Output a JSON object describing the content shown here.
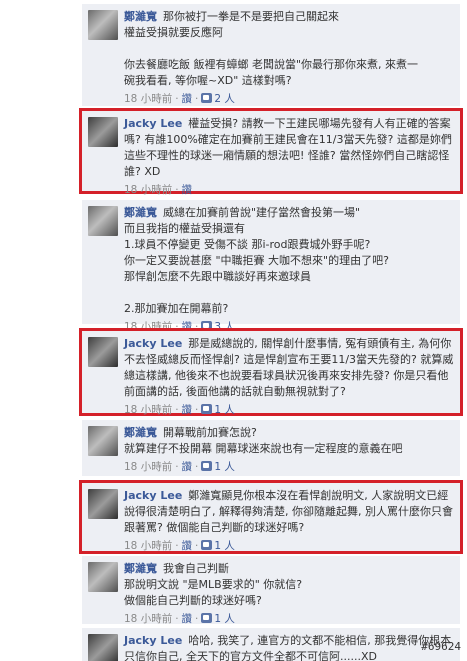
{
  "comments": [
    {
      "author": "鄭濰寬",
      "lines": [
        "那你被打一拳是不是要把自己關起來",
        "權益受損就要反應阿",
        "",
        "你去餐廳吃飯 飯裡有蟑螂 老闆說當\"你最行那你來煮, 來煮一",
        "碗我看看, 等你喔~XD\" 這樣對嗎?"
      ],
      "time": "18 小時前",
      "action": "讚",
      "likes": "2 人"
    },
    {
      "author": "Jacky Lee",
      "lines": [
        "權益受損? 請教一下王建民哪場先發有人有正確的答案嗎? 有誰100%確定在加賽前王建民會在11/3當天先發? 這都是妳們這些不理性的球迷一廂情願的想法吧! 怪誰? 當然怪妳們自己瞎認怪誰? XD"
      ],
      "time": "18 小時前",
      "action": "讚",
      "likes": ""
    },
    {
      "author": "鄭濰寬",
      "lines": [
        "威總在加賽前曾說\"建仔當然會投第一場\"",
        "而且我指的權益受損還有",
        "1.球員不停變更 受傷不談 那i-rod跟費城外野手呢?",
        "你一定又要說甚麼 \"中職拒賽 大咖不想來\"的理由了吧?",
        "那悍創怎麼不先跟中職談好再來邀球員",
        "",
        "2.那加賽加在開幕前?"
      ],
      "time": "18 小時前",
      "action": "讚",
      "likes": "3 人"
    },
    {
      "author": "Jacky Lee",
      "lines": [
        "那是威總說的, 關悍創什麼事情, 冤有頭債有主, 為何你不去怪威總反而怪悍創? 這是悍創宣布王要11/3當天先發的? 就算威總這樣講, 他後來不也說要看球員狀況後再來安排先發? 你是只看他前面講的話, 後面他講的話就自動無視就對了?"
      ],
      "time": "18 小時前",
      "action": "讚",
      "likes": "1 人"
    },
    {
      "author": "鄭濰寬",
      "lines": [
        "開幕戰前加賽怎說?",
        "就算建仔不投開幕 開幕球迷來說也有一定程度的意義在吧"
      ],
      "time": "18 小時前",
      "action": "讚",
      "likes": "1 人"
    },
    {
      "author": "Jacky Lee",
      "lines": [
        "鄭濰寬顯見你根本沒在看悍創說明文, 人家說明文已經說得很清楚明白了, 解釋得夠清楚, 你卻隨離起舞, 別人罵什麼你只會跟著罵? 做個能自己判斷的球迷好嗎?"
      ],
      "time": "18 小時前",
      "action": "讚",
      "likes": "1 人"
    },
    {
      "author": "鄭濰寬",
      "lines": [
        "我會自己判斷",
        "那說明文說 \"是MLB要求的\" 你就信?",
        "做個能自己判斷的球迷好嗎?"
      ],
      "time": "18 小時前",
      "action": "讚",
      "likes": "1 人"
    },
    {
      "author": "Jacky Lee",
      "lines": [
        "哈哈, 我笑了, 連官方的文都不能相信, 那我覺得你根本只信你自己, 全天下的官方文件全都不可信阿......XD"
      ],
      "time": "",
      "action": "",
      "likes": ""
    }
  ],
  "watermark": "#69624"
}
